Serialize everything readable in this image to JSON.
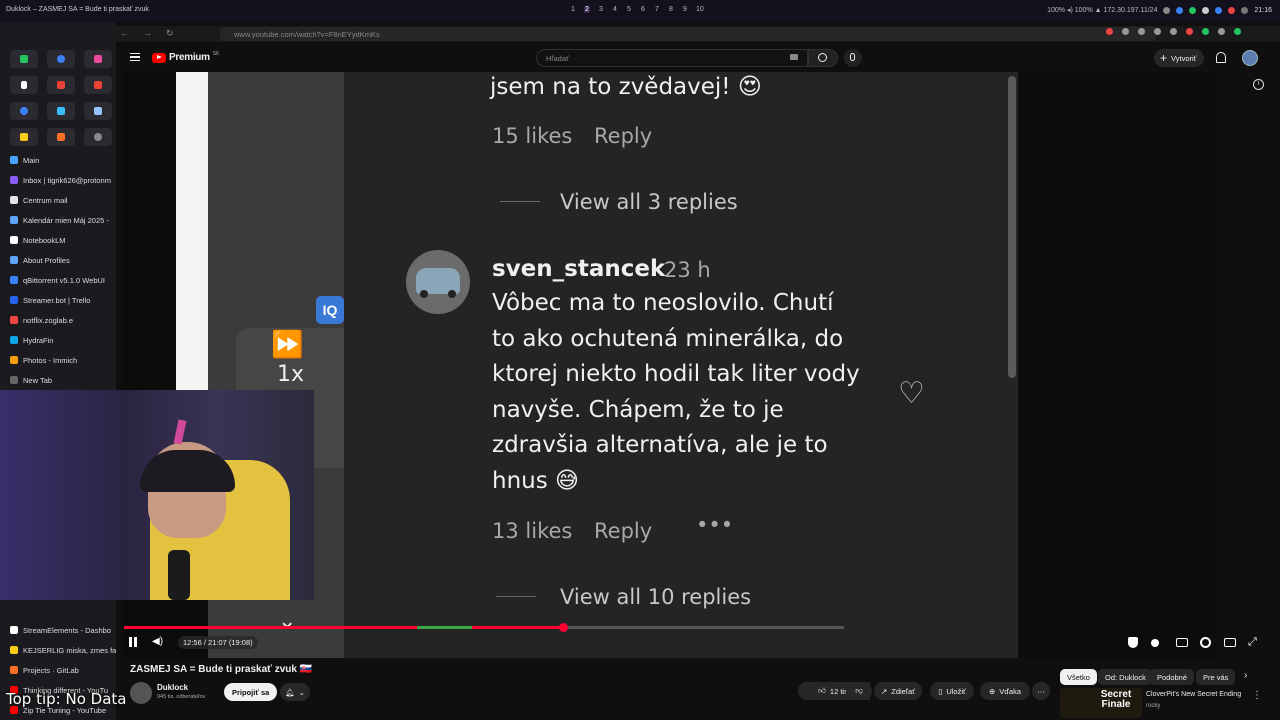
{
  "os": {
    "window_title": "Duklock – ZASMEJ SA = Bude ti praskať zvuk",
    "workspaces": [
      "1",
      "2",
      "3",
      "4",
      "5",
      "6",
      "7",
      "8",
      "9",
      "10"
    ],
    "active_workspace": "2",
    "status_text": "100%  ◂) 100%  ▲ 172.30.197.11/24",
    "clock": "21:16"
  },
  "browser": {
    "url": "www.youtube.com/watch?v=F8nEYydKmKs"
  },
  "sidebar": {
    "tabs": [
      {
        "label": "Main",
        "color": "#4aa3ff"
      },
      {
        "label": "Inbox | tigrik626@protonm",
        "color": "#8b5cf6"
      },
      {
        "label": "Centrum mail",
        "color": "#e5e5e5"
      },
      {
        "label": "Kalendár mien Máj 2025 -",
        "color": "#60a5fa"
      },
      {
        "label": "NotebookLM",
        "color": "#ffffff"
      },
      {
        "label": "About Profiles",
        "color": "#60a5fa"
      },
      {
        "label": "qBittorrent v5.1.0 WebUI",
        "color": "#3b82f6"
      },
      {
        "label": "Streamer.bot | Trello",
        "color": "#2563eb"
      },
      {
        "label": "notflix.zoglab.e",
        "color": "#ef4444"
      },
      {
        "label": "HydraFin",
        "color": "#0ea5e9"
      },
      {
        "label": "Photos - Immich",
        "color": "#f59e0b"
      },
      {
        "label": "New Tab",
        "color": "#666666"
      }
    ],
    "bottom_tabs": [
      {
        "label": "StreamElements - Dashbo",
        "color": "#ffffff"
      },
      {
        "label": "KEJSERLIG miska, zmes fa",
        "color": "#facc15"
      },
      {
        "label": "Projects · GitLab",
        "color": "#fc6d26"
      },
      {
        "label": "Thinking different - YouTu",
        "color": "#ff0000"
      },
      {
        "label": "Zip Tie Tuning - YouTube",
        "color": "#ff0000"
      }
    ]
  },
  "youtube": {
    "brand": "Premium",
    "brand_sup": "SK",
    "search_placeholder": "Hľadať",
    "create_label": "Vytvoriť"
  },
  "video_content": {
    "c1_text": "jsem na to zvědavej! 😍",
    "c1_likes": "15 likes",
    "reply": "Reply",
    "view_replies_1": "View all 3 replies",
    "c2_user": "sven_stancek",
    "c2_time": "23 h",
    "c2_lines": [
      "Vôbec ma to neoslovilo. Chutí",
      "to ako ochutená minerálka, do",
      "ktorej niekto hodil tak liter vody",
      "navyše. Chápem, že to je",
      "zdravšia alternatíva, ale je to",
      "hnus 😅"
    ],
    "c2_likes": "13 likes",
    "more": "•••",
    "view_replies_2": "View all 10 replies",
    "speed": "1x",
    "iq_badge": "IQ"
  },
  "player": {
    "time": "12:56 / 21:07 (19:08)",
    "progress_fraction": 0.61
  },
  "overlay": {
    "tip": "Top tip: No Data"
  },
  "below": {
    "title": "ZASMEJ SA = Bude ti praskať zvuk 🇸🇰",
    "channel": "Duklock",
    "subs": "945 tis. odberateľov",
    "join": "Pripojiť sa",
    "likes": "12 tis.",
    "share": "Zdieľať",
    "save": "Uložiť",
    "thanks": "Vďaka",
    "chips": [
      "Všetko",
      "Od: Duklock",
      "Podobné",
      "Pre vás"
    ],
    "rec_title": "CloverPit's New Secret Ending",
    "rec_channel": "rocky",
    "rec_thumb_text": "Secret Finale"
  }
}
